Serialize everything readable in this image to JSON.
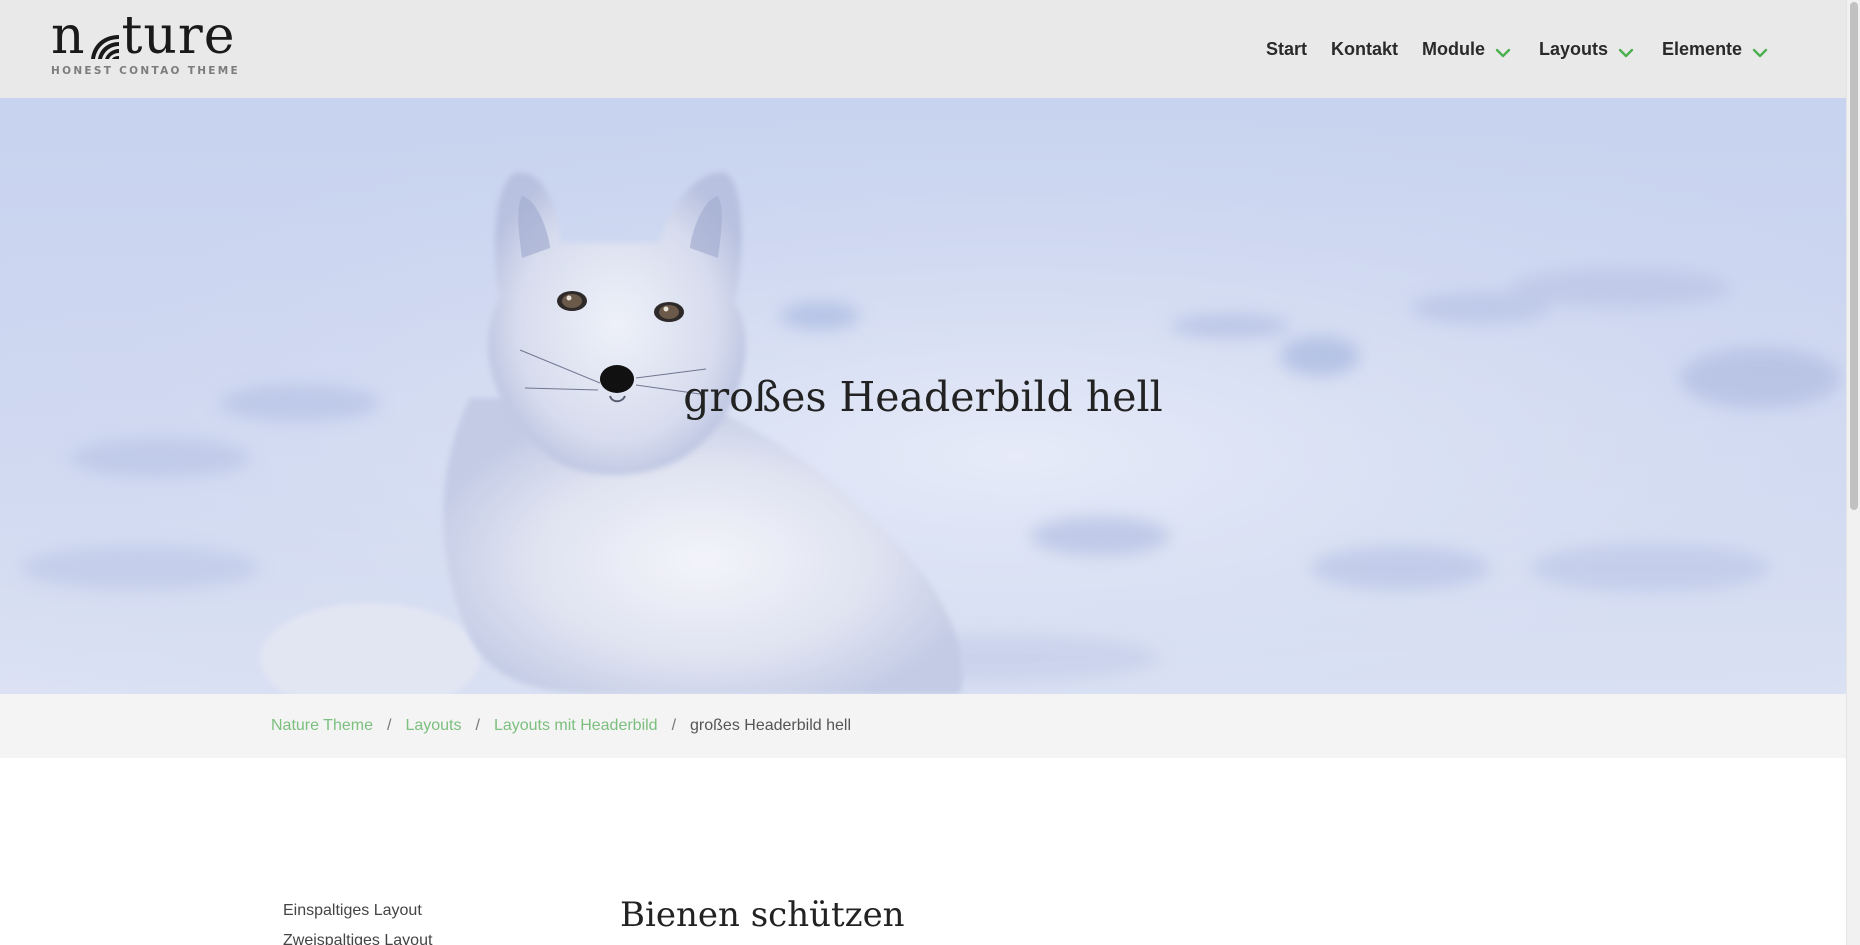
{
  "header": {
    "logo_word": "nature",
    "logo_tagline": "HONEST CONTAO THEME",
    "nav": {
      "start": "Start",
      "kontakt": "Kontakt",
      "module": "Module",
      "layouts": "Layouts",
      "elemente": "Elemente"
    },
    "accent_color": "#4caf50"
  },
  "hero": {
    "title": "großes Headerbild hell",
    "image_subject": "arctic fox in snow"
  },
  "breadcrumb": {
    "items": [
      "Nature Theme",
      "Layouts",
      "Layouts mit Headerbild"
    ],
    "separator": "/",
    "current": "großes Headerbild hell",
    "link_color": "#7cbf7e"
  },
  "sidebar": {
    "items": [
      "Einspaltiges Layout",
      "Zweispaltiges Layout"
    ]
  },
  "main": {
    "title": "Bienen schützen"
  }
}
